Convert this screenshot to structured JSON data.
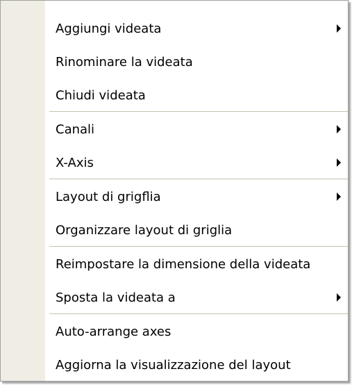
{
  "menu": {
    "items": [
      {
        "label": "Aggiungi videata",
        "submenu": true
      },
      {
        "label": "Rinominare la videata",
        "submenu": false
      },
      {
        "label": "Chiudi videata",
        "submenu": false
      },
      {
        "label": "Canali",
        "submenu": true
      },
      {
        "label": "X-Axis",
        "submenu": true
      },
      {
        "label": "Layout di grigflia",
        "submenu": true
      },
      {
        "label": "Organizzare layout di griglia",
        "submenu": false
      },
      {
        "label": "Reimpostare la dimensione della videata",
        "submenu": false
      },
      {
        "label": "Sposta la videata a",
        "submenu": true
      },
      {
        "label": "Auto-arrange axes",
        "submenu": false
      },
      {
        "label": "Aggiorna la visualizzazione del layout",
        "submenu": false
      }
    ]
  },
  "colors": {
    "gutter": "#f0eee4",
    "separator": "#c5c2b2",
    "border": "#a0a0a0",
    "text": "#000000"
  },
  "icons": {
    "submenu_arrow": "chevron-right-icon"
  }
}
